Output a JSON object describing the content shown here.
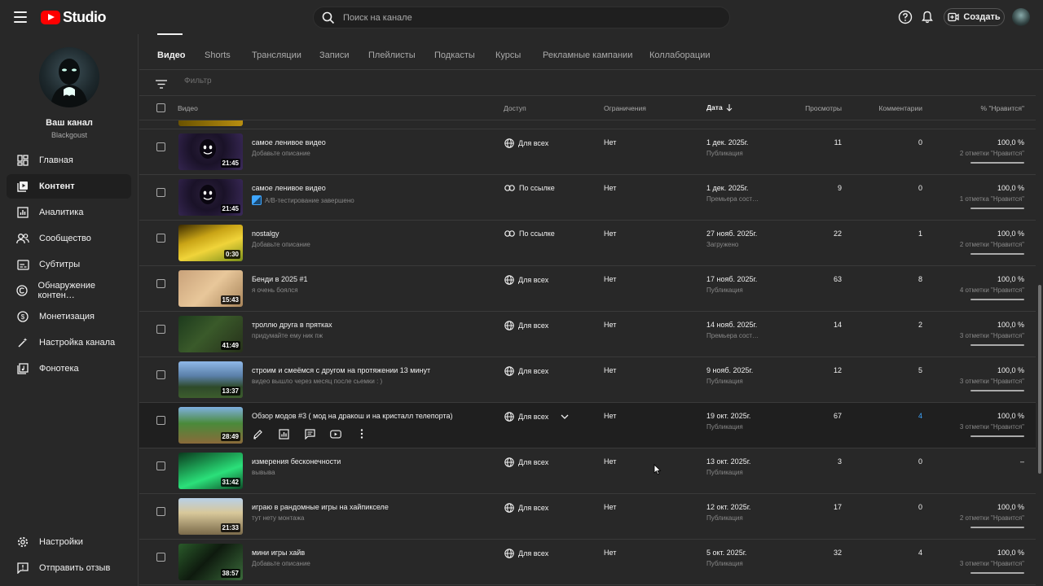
{
  "header": {
    "logo_text": "Studio",
    "search_placeholder": "Поиск на канале",
    "create_label": "Создать"
  },
  "channel": {
    "title": "Ваш канал",
    "handle": "Blackgoust"
  },
  "sidebar": {
    "items": [
      {
        "label": "Главная",
        "icon": "dashboard-icon"
      },
      {
        "label": "Контент",
        "icon": "content-icon",
        "active": true
      },
      {
        "label": "Аналитика",
        "icon": "analytics-icon"
      },
      {
        "label": "Сообщество",
        "icon": "community-icon"
      },
      {
        "label": "Субтитры",
        "icon": "subtitles-icon"
      },
      {
        "label": "Обнаружение контен…",
        "icon": "copyright-icon"
      },
      {
        "label": "Монетизация",
        "icon": "monetization-icon"
      },
      {
        "label": "Настройка канала",
        "icon": "customization-icon"
      },
      {
        "label": "Фонотека",
        "icon": "audio-library-icon"
      }
    ],
    "bottom": [
      {
        "label": "Настройки",
        "icon": "settings-icon"
      },
      {
        "label": "Отправить отзыв",
        "icon": "feedback-icon"
      }
    ]
  },
  "tabs": [
    "Видео",
    "Shorts",
    "Трансляции",
    "Записи",
    "Плейлисты",
    "Подкасты",
    "Курсы",
    "Рекламные кампании",
    "Коллаборации"
  ],
  "filter": {
    "placeholder": "Фильтр"
  },
  "columns": {
    "video": "Видео",
    "access": "Доступ",
    "restrictions": "Ограничения",
    "date": "Дата",
    "views": "Просмотры",
    "comments": "Комментарии",
    "likes": "% \"Нравится\""
  },
  "videos": [
    {
      "title": "самое ленивое видео",
      "desc": "Добавьте описание",
      "duration": "21:45",
      "access": "Для всех",
      "access_icon": "globe-icon",
      "restrictions": "Нет",
      "date": "1 дек. 2025г.",
      "date_status": "Публикация",
      "views": "11",
      "comments": "0",
      "likes": "100,0 %",
      "likes_sub": "2 отметки \"Нравится\""
    },
    {
      "title": "самое ленивое видео",
      "desc": "A/B-тестирование завершено",
      "ab": true,
      "duration": "21:45",
      "access": "По ссылке",
      "access_icon": "link-icon",
      "restrictions": "Нет",
      "date": "1 дек. 2025г.",
      "date_status": "Премьера сост…",
      "views": "9",
      "comments": "0",
      "likes": "100,0 %",
      "likes_sub": "1 отметка \"Нравится\""
    },
    {
      "title": "nostalgy",
      "desc": "Добавьте описание",
      "duration": "0:30",
      "access": "По ссылке",
      "access_icon": "link-icon",
      "restrictions": "Нет",
      "date": "27 нояб. 2025г.",
      "date_status": "Загружено",
      "views": "22",
      "comments": "1",
      "likes": "100,0 %",
      "likes_sub": "2 отметки \"Нравится\""
    },
    {
      "title": "Бенди в 2025 #1",
      "desc": "я очень боялся",
      "duration": "15:43",
      "access": "Для всех",
      "access_icon": "globe-icon",
      "restrictions": "Нет",
      "date": "17 нояб. 2025г.",
      "date_status": "Публикация",
      "views": "63",
      "comments": "8",
      "likes": "100,0 %",
      "likes_sub": "4 отметки \"Нравится\""
    },
    {
      "title": "троллю друга в прятках",
      "desc": "придумайте ему ник пж",
      "duration": "41:49",
      "access": "Для всех",
      "access_icon": "globe-icon",
      "restrictions": "Нет",
      "date": "14 нояб. 2025г.",
      "date_status": "Премьера сост…",
      "views": "14",
      "comments": "2",
      "likes": "100,0 %",
      "likes_sub": "3 отметки \"Нравится\""
    },
    {
      "title": "строим и смеёмся с другом на протяжении 13 минут",
      "desc": "видео вышло через месяц после сьемки : )",
      "duration": "13:37",
      "access": "Для всех",
      "access_icon": "globe-icon",
      "restrictions": "Нет",
      "date": "9 нояб. 2025г.",
      "date_status": "Публикация",
      "views": "12",
      "comments": "5",
      "likes": "100,0 %",
      "likes_sub": "3 отметки \"Нравится\""
    },
    {
      "title": "Обзор модов #3 ( мод на дракош и на кристалл телепорта)",
      "desc": "",
      "duration": "28:49",
      "access": "Для всех",
      "access_icon": "globe-icon",
      "hover": true,
      "restrictions": "Нет",
      "date": "19 окт. 2025г.",
      "date_status": "Публикация",
      "views": "67",
      "comments": "4",
      "likes": "100,0 %",
      "likes_sub": "3 отметки \"Нравится\""
    },
    {
      "title": "измерения бесконечности",
      "desc": "вывыва",
      "duration": "31:42",
      "access": "Для всех",
      "access_icon": "globe-icon",
      "restrictions": "Нет",
      "date": "13 окт. 2025г.",
      "date_status": "Публикация",
      "views": "3",
      "comments": "0",
      "likes": "–",
      "likes_sub": ""
    },
    {
      "title": "играю в рандомные игры на хайпикселе",
      "desc": "тут нету монтажа",
      "duration": "21:33",
      "access": "Для всех",
      "access_icon": "globe-icon",
      "restrictions": "Нет",
      "date": "12 окт. 2025г.",
      "date_status": "Публикация",
      "views": "17",
      "comments": "0",
      "likes": "100,0 %",
      "likes_sub": "2 отметки \"Нравится\""
    },
    {
      "title": "мини игры хайв",
      "desc": "Добавьте описание",
      "duration": "38:57",
      "access": "Для всех",
      "access_icon": "globe-icon",
      "restrictions": "Нет",
      "date": "5 окт. 2025г.",
      "date_status": "Публикация",
      "views": "32",
      "comments": "4",
      "likes": "100,0 %",
      "likes_sub": "3 отметки \"Нравится\""
    }
  ]
}
